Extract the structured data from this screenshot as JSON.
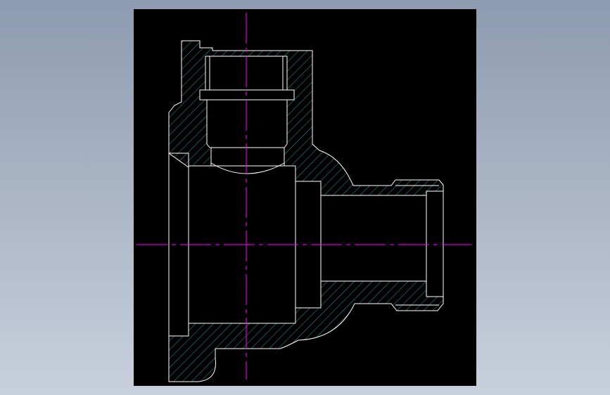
{
  "drawing": {
    "type": "cad-section-view",
    "subject": "tee-fitting-cross-section",
    "colors": {
      "background": "#000000",
      "outline": "#ffffff",
      "hatch": "#38c8c8",
      "centerline": "#ff00ff"
    }
  }
}
